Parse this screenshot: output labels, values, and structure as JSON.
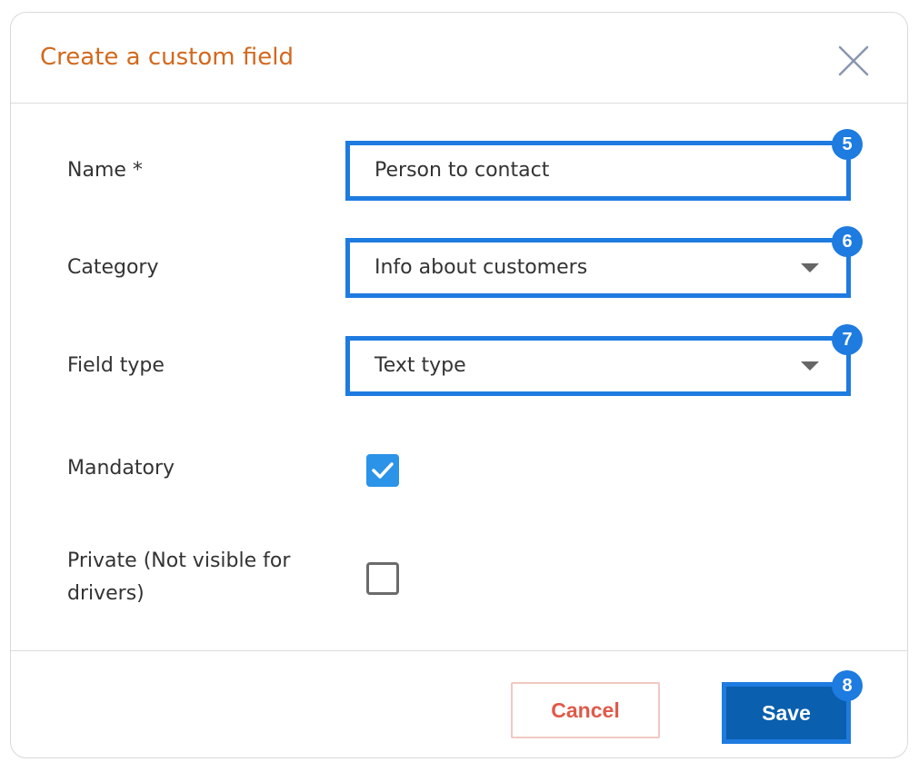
{
  "dialog": {
    "title": "Create a custom field"
  },
  "fields": {
    "name": {
      "label": "Name *",
      "value": "Person to contact",
      "badge": "5"
    },
    "category": {
      "label": "Category",
      "value": "Info about customers",
      "badge": "6"
    },
    "field_type": {
      "label": "Field type",
      "value": "Text type",
      "badge": "7"
    },
    "mandatory": {
      "label": "Mandatory",
      "checked": true
    },
    "private": {
      "label_line1": "Private (Not visible for",
      "label_line2": "drivers)",
      "checked": false
    }
  },
  "footer": {
    "cancel_label": "Cancel",
    "save_label": "Save",
    "save_badge": "8"
  },
  "colors": {
    "title": "#d2691e",
    "highlight": "#1e7be0",
    "checkbox_checked": "#2b93e8",
    "save_button": "#0a5fae",
    "cancel_text": "#e05a4a"
  },
  "icons": {
    "close": "close-icon",
    "dropdown": "caret-down-icon",
    "check": "checkmark-icon"
  }
}
